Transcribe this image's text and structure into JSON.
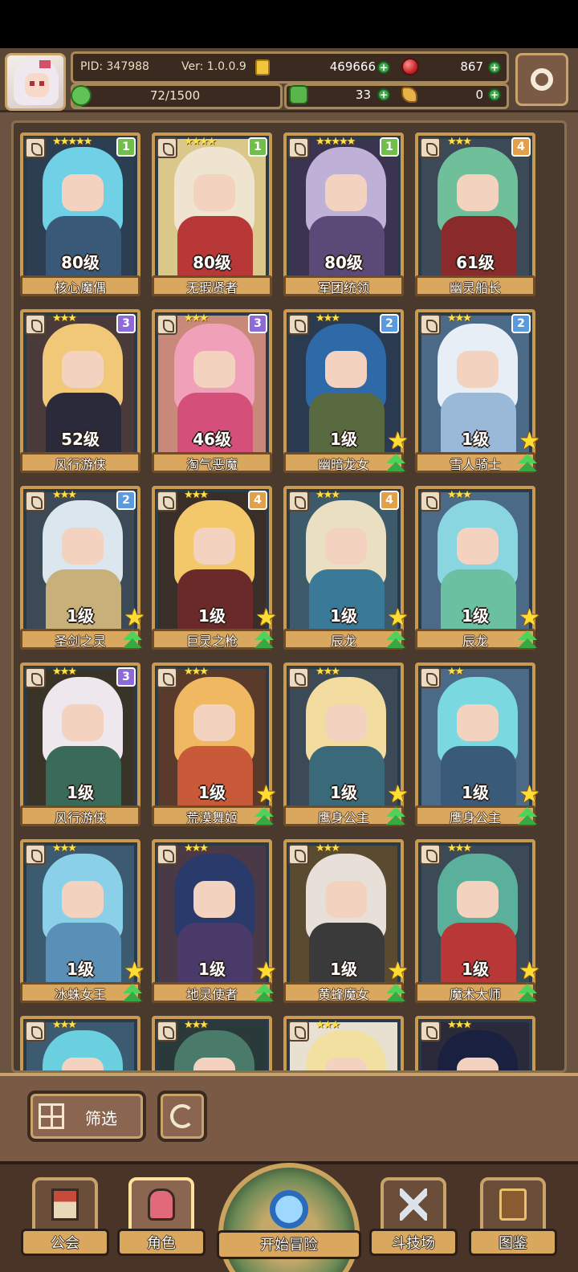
{
  "header": {
    "pid": "PID: 347988",
    "version": "Ver: 1.0.0.9",
    "gold": "469666",
    "gems": "867",
    "xp": "72/1500",
    "xp_fraction": 0.048,
    "clover": "33",
    "horn": "0",
    "plus": "+"
  },
  "cards": [
    {
      "level": "80级",
      "name": "核心魔偶",
      "stars": "★★★★★",
      "badge": "1",
      "badge_color": "green",
      "hair": "#6fd0e6",
      "body": "#3a5878",
      "bg": "#2c3e52",
      "show_upgrade": false
    },
    {
      "level": "80级",
      "name": "无瑕贤者",
      "stars": "★★★★",
      "badge": "1",
      "badge_color": "green",
      "hair": "#efe4d0",
      "body": "#b83838",
      "bg": "#d9c88a",
      "show_upgrade": false
    },
    {
      "level": "80级",
      "name": "军团统领",
      "stars": "★★★★★",
      "badge": "1",
      "badge_color": "green",
      "hair": "#bfb0d8",
      "body": "#5b4a78",
      "bg": "#3a3450",
      "show_upgrade": false
    },
    {
      "level": "61级",
      "name": "幽灵船长",
      "stars": "★★★",
      "badge": "4",
      "badge_color": "orange",
      "hair": "#6fbf9a",
      "body": "#8a2a2a",
      "bg": "#3c4a58",
      "show_upgrade": false
    },
    {
      "level": "52级",
      "name": "风行游侠",
      "stars": "★★★",
      "badge": "3",
      "badge_color": "purple",
      "hair": "#f0c878",
      "body": "#2a2a3a",
      "bg": "#4a3a3a",
      "show_upgrade": false
    },
    {
      "level": "46级",
      "name": "淘气恶魔",
      "stars": "★★★",
      "badge": "3",
      "badge_color": "purple",
      "hair": "#f0a0b8",
      "body": "#d4507a",
      "bg": "#c8887a",
      "show_upgrade": false
    },
    {
      "level": "1级",
      "name": "幽暗龙女",
      "stars": "★★★",
      "badge": "2",
      "badge_color": "blue",
      "hair": "#2f6aa8",
      "body": "#5a6a40",
      "bg": "#2a3a50",
      "show_upgrade": true
    },
    {
      "level": "1级",
      "name": "雪人骑士",
      "stars": "★★★",
      "badge": "2",
      "badge_color": "blue",
      "hair": "#e8eef6",
      "body": "#9ab8d8",
      "bg": "#4a6a88",
      "show_upgrade": true
    },
    {
      "level": "1级",
      "name": "圣剑之灵",
      "stars": "★★★",
      "badge": "2",
      "badge_color": "blue",
      "hair": "#dbe6ee",
      "body": "#c8b07a",
      "bg": "#3c4a58",
      "show_upgrade": true
    },
    {
      "level": "1级",
      "name": "巨灵之枪",
      "stars": "★★★",
      "badge": "4",
      "badge_color": "orange",
      "hair": "#f2c86a",
      "body": "#6a2a2a",
      "bg": "#3a2e28",
      "show_upgrade": true
    },
    {
      "level": "1级",
      "name": "辰龙",
      "stars": "★★★",
      "badge": "4",
      "badge_color": "orange",
      "hair": "#eadfc0",
      "body": "#3a7a98",
      "bg": "#3c5a6a",
      "show_upgrade": true
    },
    {
      "level": "1级",
      "name": "辰龙",
      "stars": "★★★",
      "badge": "",
      "badge_color": "",
      "hair": "#8ad6e0",
      "body": "#6ac0a0",
      "bg": "#4a6a88",
      "show_upgrade": true
    },
    {
      "level": "1级",
      "name": "风行游侠",
      "stars": "★★★",
      "badge": "3",
      "badge_color": "purple",
      "hair": "#eee8ee",
      "body": "#3a6a5a",
      "bg": "#3a3428",
      "show_upgrade": false
    },
    {
      "level": "1级",
      "name": "荒漠舞姬",
      "stars": "★★★",
      "badge": "",
      "badge_color": "",
      "hair": "#f0b860",
      "body": "#c85a3a",
      "bg": "#5a3a2a",
      "show_upgrade": true
    },
    {
      "level": "1级",
      "name": "鹰身公主",
      "stars": "★★★",
      "badge": "",
      "badge_color": "",
      "hair": "#f2dca0",
      "body": "#3a6a7a",
      "bg": "#3c4a58",
      "show_upgrade": true
    },
    {
      "level": "1级",
      "name": "鹰身公主",
      "stars": "★★",
      "badge": "",
      "badge_color": "",
      "hair": "#7ad8e0",
      "body": "#3a5a7a",
      "bg": "#4a6a88",
      "show_upgrade": true
    },
    {
      "level": "1级",
      "name": "冰蛛女王",
      "stars": "★★★",
      "badge": "",
      "badge_color": "",
      "hair": "#8ad0e8",
      "body": "#5a90b8",
      "bg": "#3c5a70",
      "show_upgrade": true
    },
    {
      "level": "1级",
      "name": "地灵使者",
      "stars": "★★★",
      "badge": "",
      "badge_color": "",
      "hair": "#2a3a6a",
      "body": "#4a3a6a",
      "bg": "#4a3a48",
      "show_upgrade": true
    },
    {
      "level": "1级",
      "name": "黄蜂魔女",
      "stars": "★★★",
      "badge": "",
      "badge_color": "",
      "hair": "#e6e0d8",
      "body": "#3a3a3a",
      "bg": "#5a4a30",
      "show_upgrade": true
    },
    {
      "level": "1级",
      "name": "魔术大师",
      "stars": "★★★",
      "badge": "",
      "badge_color": "",
      "hair": "#5ab09a",
      "body": "#b83838",
      "bg": "#3c4a58",
      "show_upgrade": true
    },
    {
      "level": "",
      "name": "",
      "stars": "★★★",
      "badge": "",
      "badge_color": "",
      "hair": "#6ad0e0",
      "body": "#2a6a98",
      "bg": "#3c5a70",
      "show_upgrade": false
    },
    {
      "level": "",
      "name": "",
      "stars": "★★★",
      "badge": "",
      "badge_color": "",
      "hair": "#4a7a6a",
      "body": "#2a4a3a",
      "bg": "#2a3a3a",
      "show_upgrade": false
    },
    {
      "level": "",
      "name": "",
      "stars": "★★★",
      "badge": "",
      "badge_color": "",
      "hair": "#f2e0a0",
      "body": "#d8c8a0",
      "bg": "#e8e0d0",
      "show_upgrade": false
    },
    {
      "level": "",
      "name": "",
      "stars": "★★★",
      "badge": "",
      "badge_color": "",
      "hair": "#1a2040",
      "body": "#3a3a5a",
      "bg": "#2a2a3a",
      "show_upgrade": false
    }
  ],
  "filter": {
    "label": "筛选"
  },
  "nav": {
    "guild": "公会",
    "characters": "角色",
    "adventure": "开始冒险",
    "arena": "斗技场",
    "codex": "图鉴"
  },
  "colors": {
    "frame": "#c89a52",
    "background": "#4a3a2e",
    "accent_green": "#3fa64a"
  }
}
